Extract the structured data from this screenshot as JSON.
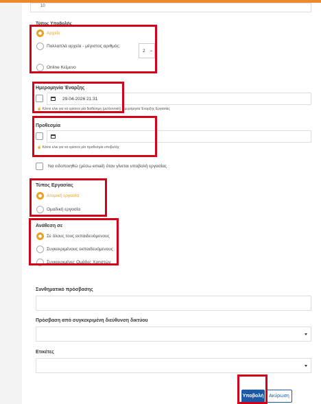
{
  "top_field": {
    "value": "10"
  },
  "submission_type": {
    "label": "Τύπος Υποβολής",
    "options": [
      {
        "label": "Αρχείο"
      },
      {
        "label": "Πολλαπλά αρχεία - μέγιστος αριθμός:"
      },
      {
        "label": "Online Κείμενο"
      }
    ],
    "max_files": "2"
  },
  "start_date": {
    "label": "Ημερομηνία Έναρξης",
    "value": "29-04-2026 21:31",
    "help": "Κάντε κλικ για να ορίσετε μία διαθέσιμη (μελλοντική) Ημερομηνία Έναρξης Εργασίας"
  },
  "deadline": {
    "label": "Προθεσμία",
    "help": "Κάντε κλικ για να ορίσετε μία προθεσμία υποβολής"
  },
  "notify": {
    "label": "Να ειδοποιηθώ (μέσω email) όταν γίνεται υποβολή εργασίας"
  },
  "work_type": {
    "label": "Τύπος Εργασίας",
    "options": [
      {
        "label": "Ατομική εργασία"
      },
      {
        "label": "Ομαδική εργασία"
      }
    ]
  },
  "assign": {
    "label": "Ανάθεση σε",
    "options": [
      {
        "label": "Σε όλους τους εκπαιδευόμενους"
      },
      {
        "label": "Συγκεκριμένους εκπαιδευόμενους"
      },
      {
        "label": "Συγκεκριμένες Ομάδες Χρηστών"
      }
    ]
  },
  "password": {
    "label": "Συνθηματικό πρόσβασης"
  },
  "ip_access": {
    "label": "Πρόσβαση από συγκεκριμένη διεύθυνση δικτύου"
  },
  "tags": {
    "label": "Ετικέτες"
  },
  "buttons": {
    "submit": "Υποβολή",
    "cancel": "Ακύρωση"
  },
  "colors": {
    "accent": "#e9a11a",
    "highlight": "#d40018",
    "primary": "#1c5aa6",
    "topbar": "#e98b2a"
  }
}
